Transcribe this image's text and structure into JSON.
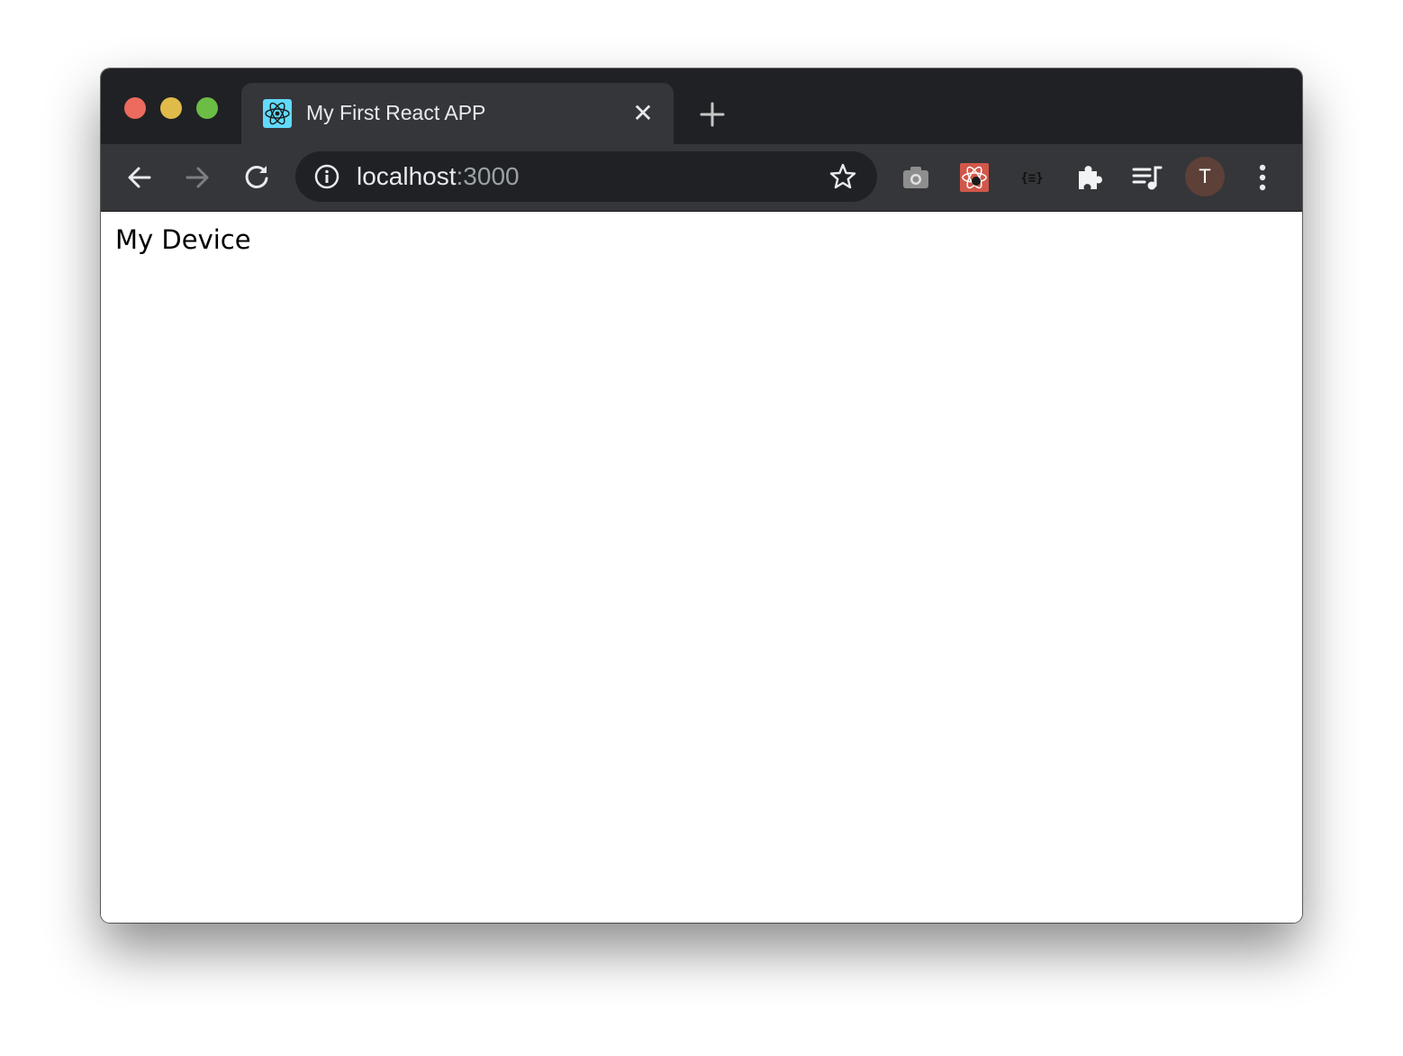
{
  "window": {
    "traffic_lights": [
      {
        "name": "close",
        "color": "#ec6a5e"
      },
      {
        "name": "minimize",
        "color": "#e0bb4a"
      },
      {
        "name": "maximize",
        "color": "#6bbd45"
      }
    ]
  },
  "tabs": [
    {
      "title": "My First React APP",
      "favicon": "react-logo-icon",
      "active": true,
      "close_label": "✕"
    }
  ],
  "new_tab_label": "+",
  "toolbar": {
    "back": "arrow-left-icon",
    "forward": "arrow-right-icon",
    "reload": "reload-icon",
    "url_host": "localhost",
    "url_port": ":3000",
    "bookmark": "star-icon",
    "extensions": [
      "camera-icon",
      "react-devtools-icon",
      "json-formatter-icon",
      "puzzle-icon",
      "media-queue-icon"
    ],
    "profile_initial": "T",
    "profile_color": "#5d4037",
    "menu": "more-vert-icon"
  },
  "page": {
    "text": "My Device"
  }
}
